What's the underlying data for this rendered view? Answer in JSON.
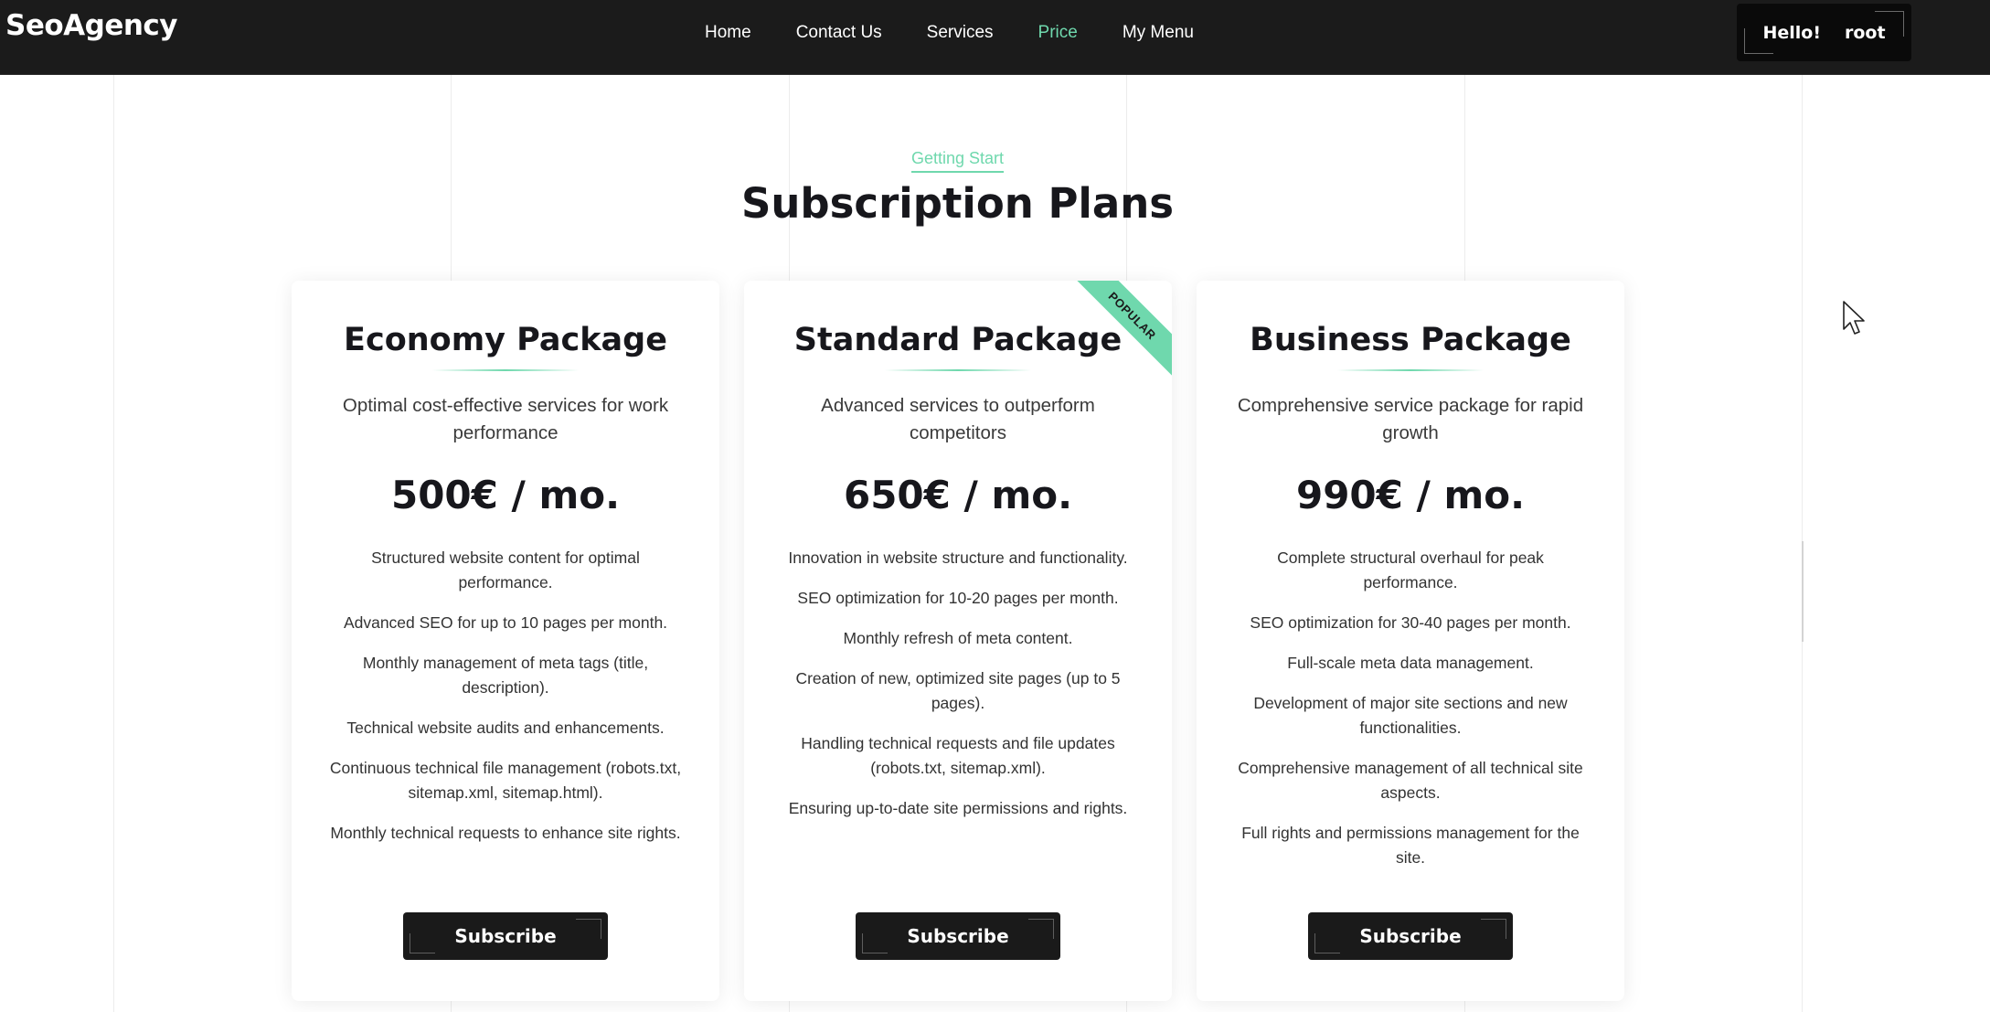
{
  "header": {
    "logo": "SeoAgency",
    "nav": [
      {
        "label": "Home",
        "active": false
      },
      {
        "label": "Contact Us",
        "active": false
      },
      {
        "label": "Services",
        "active": false
      },
      {
        "label": "Price",
        "active": true
      },
      {
        "label": "My Menu",
        "active": false
      }
    ],
    "user_greeting": "Hello!",
    "username": "root"
  },
  "section": {
    "eyebrow": "Getting Start",
    "title": "Subscription Plans"
  },
  "plans": [
    {
      "title": "Economy Package",
      "description": "Optimal cost-effective services for work performance",
      "price": "500€ / mo.",
      "features": [
        "Structured website content for optimal performance.",
        "Advanced SEO for up to 10 pages per month.",
        "Monthly management of meta tags (title, description).",
        "Technical website audits and enhancements.",
        "Continuous technical file management (robots.txt, sitemap.xml, sitemap.html).",
        "Monthly technical requests to enhance site rights."
      ],
      "button": "Subscribe"
    },
    {
      "title": "Standard Package",
      "badge": "POPULAR",
      "description": "Advanced services to outperform competitors",
      "price": "650€ / mo.",
      "features": [
        "Innovation in website structure and functionality.",
        "SEO optimization for 10-20 pages per month.",
        "Monthly refresh of meta content.",
        "Creation of new, optimized site pages (up to 5 pages).",
        "Handling technical requests and file updates (robots.txt, sitemap.xml).",
        "Ensuring up-to-date site permissions and rights."
      ],
      "button": "Subscribe"
    },
    {
      "title": "Business Package",
      "description": "Comprehensive service package for rapid growth",
      "price": "990€ / mo.",
      "features": [
        "Complete structural overhaul for peak performance.",
        "SEO optimization for 30-40 pages per month.",
        "Full-scale meta data management.",
        "Development of major site sections and new functionalities.",
        "Comprehensive management of all technical site aspects.",
        "Full rights and permissions management for the site."
      ],
      "button": "Subscribe"
    }
  ],
  "colors": {
    "header_bg": "#1b1b1b",
    "accent": "#6fd8ad",
    "button_bg": "#1a1a1a"
  },
  "icons": {
    "cursor": "mouse-pointer-icon"
  }
}
